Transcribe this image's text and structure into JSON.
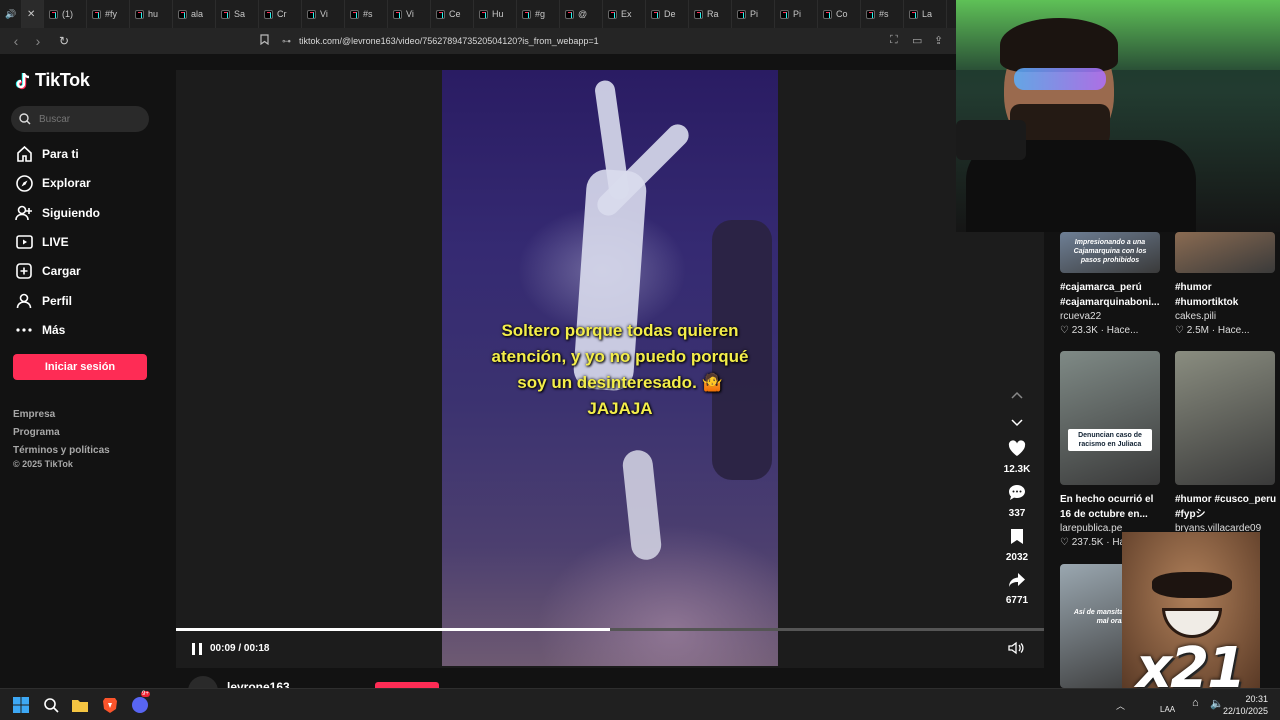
{
  "browser": {
    "tabs": [
      {
        "label": "",
        "icon": "speaker-icon"
      },
      {
        "label": "",
        "icon": "close-icon",
        "active": true
      },
      {
        "label": "(1)",
        "icon": "tiktok-icon"
      },
      {
        "label": "#fy",
        "icon": "tiktok-icon"
      },
      {
        "label": "hu",
        "icon": "tiktok-icon"
      },
      {
        "label": "ala",
        "icon": "tiktok-icon"
      },
      {
        "label": "Sa",
        "icon": "tiktok-icon"
      },
      {
        "label": "Cr",
        "icon": "tiktok-icon"
      },
      {
        "label": "Vi",
        "icon": "tiktok-icon"
      },
      {
        "label": "#s",
        "icon": "tiktok-icon"
      },
      {
        "label": "Vi",
        "icon": "tiktok-icon"
      },
      {
        "label": "Ce",
        "icon": "tiktok-icon"
      },
      {
        "label": "Hu",
        "icon": "tiktok-icon"
      },
      {
        "label": "#g",
        "icon": "tiktok-icon"
      },
      {
        "label": "@",
        "icon": "tiktok-icon"
      },
      {
        "label": "Ex",
        "icon": "tiktok-icon"
      },
      {
        "label": "De",
        "icon": "tiktok-icon"
      },
      {
        "label": "Ra",
        "icon": "tiktok-icon"
      },
      {
        "label": "Pi",
        "icon": "tiktok-icon"
      },
      {
        "label": "Pi",
        "icon": "tiktok-icon"
      },
      {
        "label": "Co",
        "icon": "tiktok-icon"
      },
      {
        "label": "#s",
        "icon": "tiktok-icon"
      },
      {
        "label": "La",
        "icon": "tiktok-icon"
      }
    ],
    "url": "tiktok.com/@levrone163/video/7562789473520504120?is_from_webapp=1"
  },
  "sidebar": {
    "logo": "TikTok",
    "search_placeholder": "Buscar",
    "nav": [
      {
        "label": "Para ti",
        "icon": "home-icon"
      },
      {
        "label": "Explorar",
        "icon": "compass-icon"
      },
      {
        "label": "Siguiendo",
        "icon": "following-icon"
      },
      {
        "label": "LIVE",
        "icon": "live-icon"
      },
      {
        "label": "Cargar",
        "icon": "upload-icon"
      },
      {
        "label": "Perfil",
        "icon": "profile-icon"
      },
      {
        "label": "Más",
        "icon": "more-icon"
      }
    ],
    "login_label": "Iniciar sesión",
    "footer": [
      "Empresa",
      "Programa",
      "Términos y políticas",
      "© 2025 TikTok"
    ]
  },
  "video": {
    "caption_lines": [
      "Soltero porque todas quieren",
      "atención, y yo no puedo porqué",
      "soy un desinteresado. 🤷",
      "JAJAJA"
    ],
    "time": "00:09 / 00:18",
    "progress": 0.5,
    "author": "levrone163"
  },
  "actions": {
    "likes": "12.3K",
    "comments": "337",
    "saves": "2032",
    "shares": "6771"
  },
  "related": [
    {
      "title_lines": [
        "#cajamarca_perú",
        "#cajamarquinaboni..."
      ],
      "author": "rcueva22",
      "stats": "23.3K · Hace...",
      "thumb_text": "Impresionando a una Cajamarquina con los pasos prohibidos",
      "thumb_color": "#6e7f95"
    },
    {
      "title_lines": [
        "#humor",
        "#humortiktok"
      ],
      "author": "cakes.pili",
      "stats": "2.5M · Hace...",
      "thumb_text": "",
      "thumb_color": "#8a6b52"
    },
    {
      "title_lines": [
        "En hecho ocurrió el",
        "16 de octubre en..."
      ],
      "author": "larepublica.pe",
      "stats": "237.5K · Ha",
      "thumb_text": "Denuncian caso de racismo en Juliaca",
      "thumb_color": "#7f8a86"
    },
    {
      "title_lines": [
        "#humor #cusco_peru",
        "#fypシ"
      ],
      "author": "bryans.villacarde09",
      "stats": "",
      "thumb_text": "",
      "thumb_color": "#8a8d80"
    },
    {
      "title_lines": [],
      "author": "",
      "stats": "",
      "thumb_text": "Así de mansita f dejar mal oral",
      "thumb_color": "#9aa7b0"
    }
  ],
  "overlay": {
    "multiplier": "x21"
  },
  "taskbar": {
    "lang": "LAA",
    "time": "20:31",
    "date": "22/10/2025",
    "discord_badge": "9+"
  },
  "colors": {
    "accent": "#fe2c55",
    "caption": "#f4ee4a",
    "bg": "#121212"
  }
}
